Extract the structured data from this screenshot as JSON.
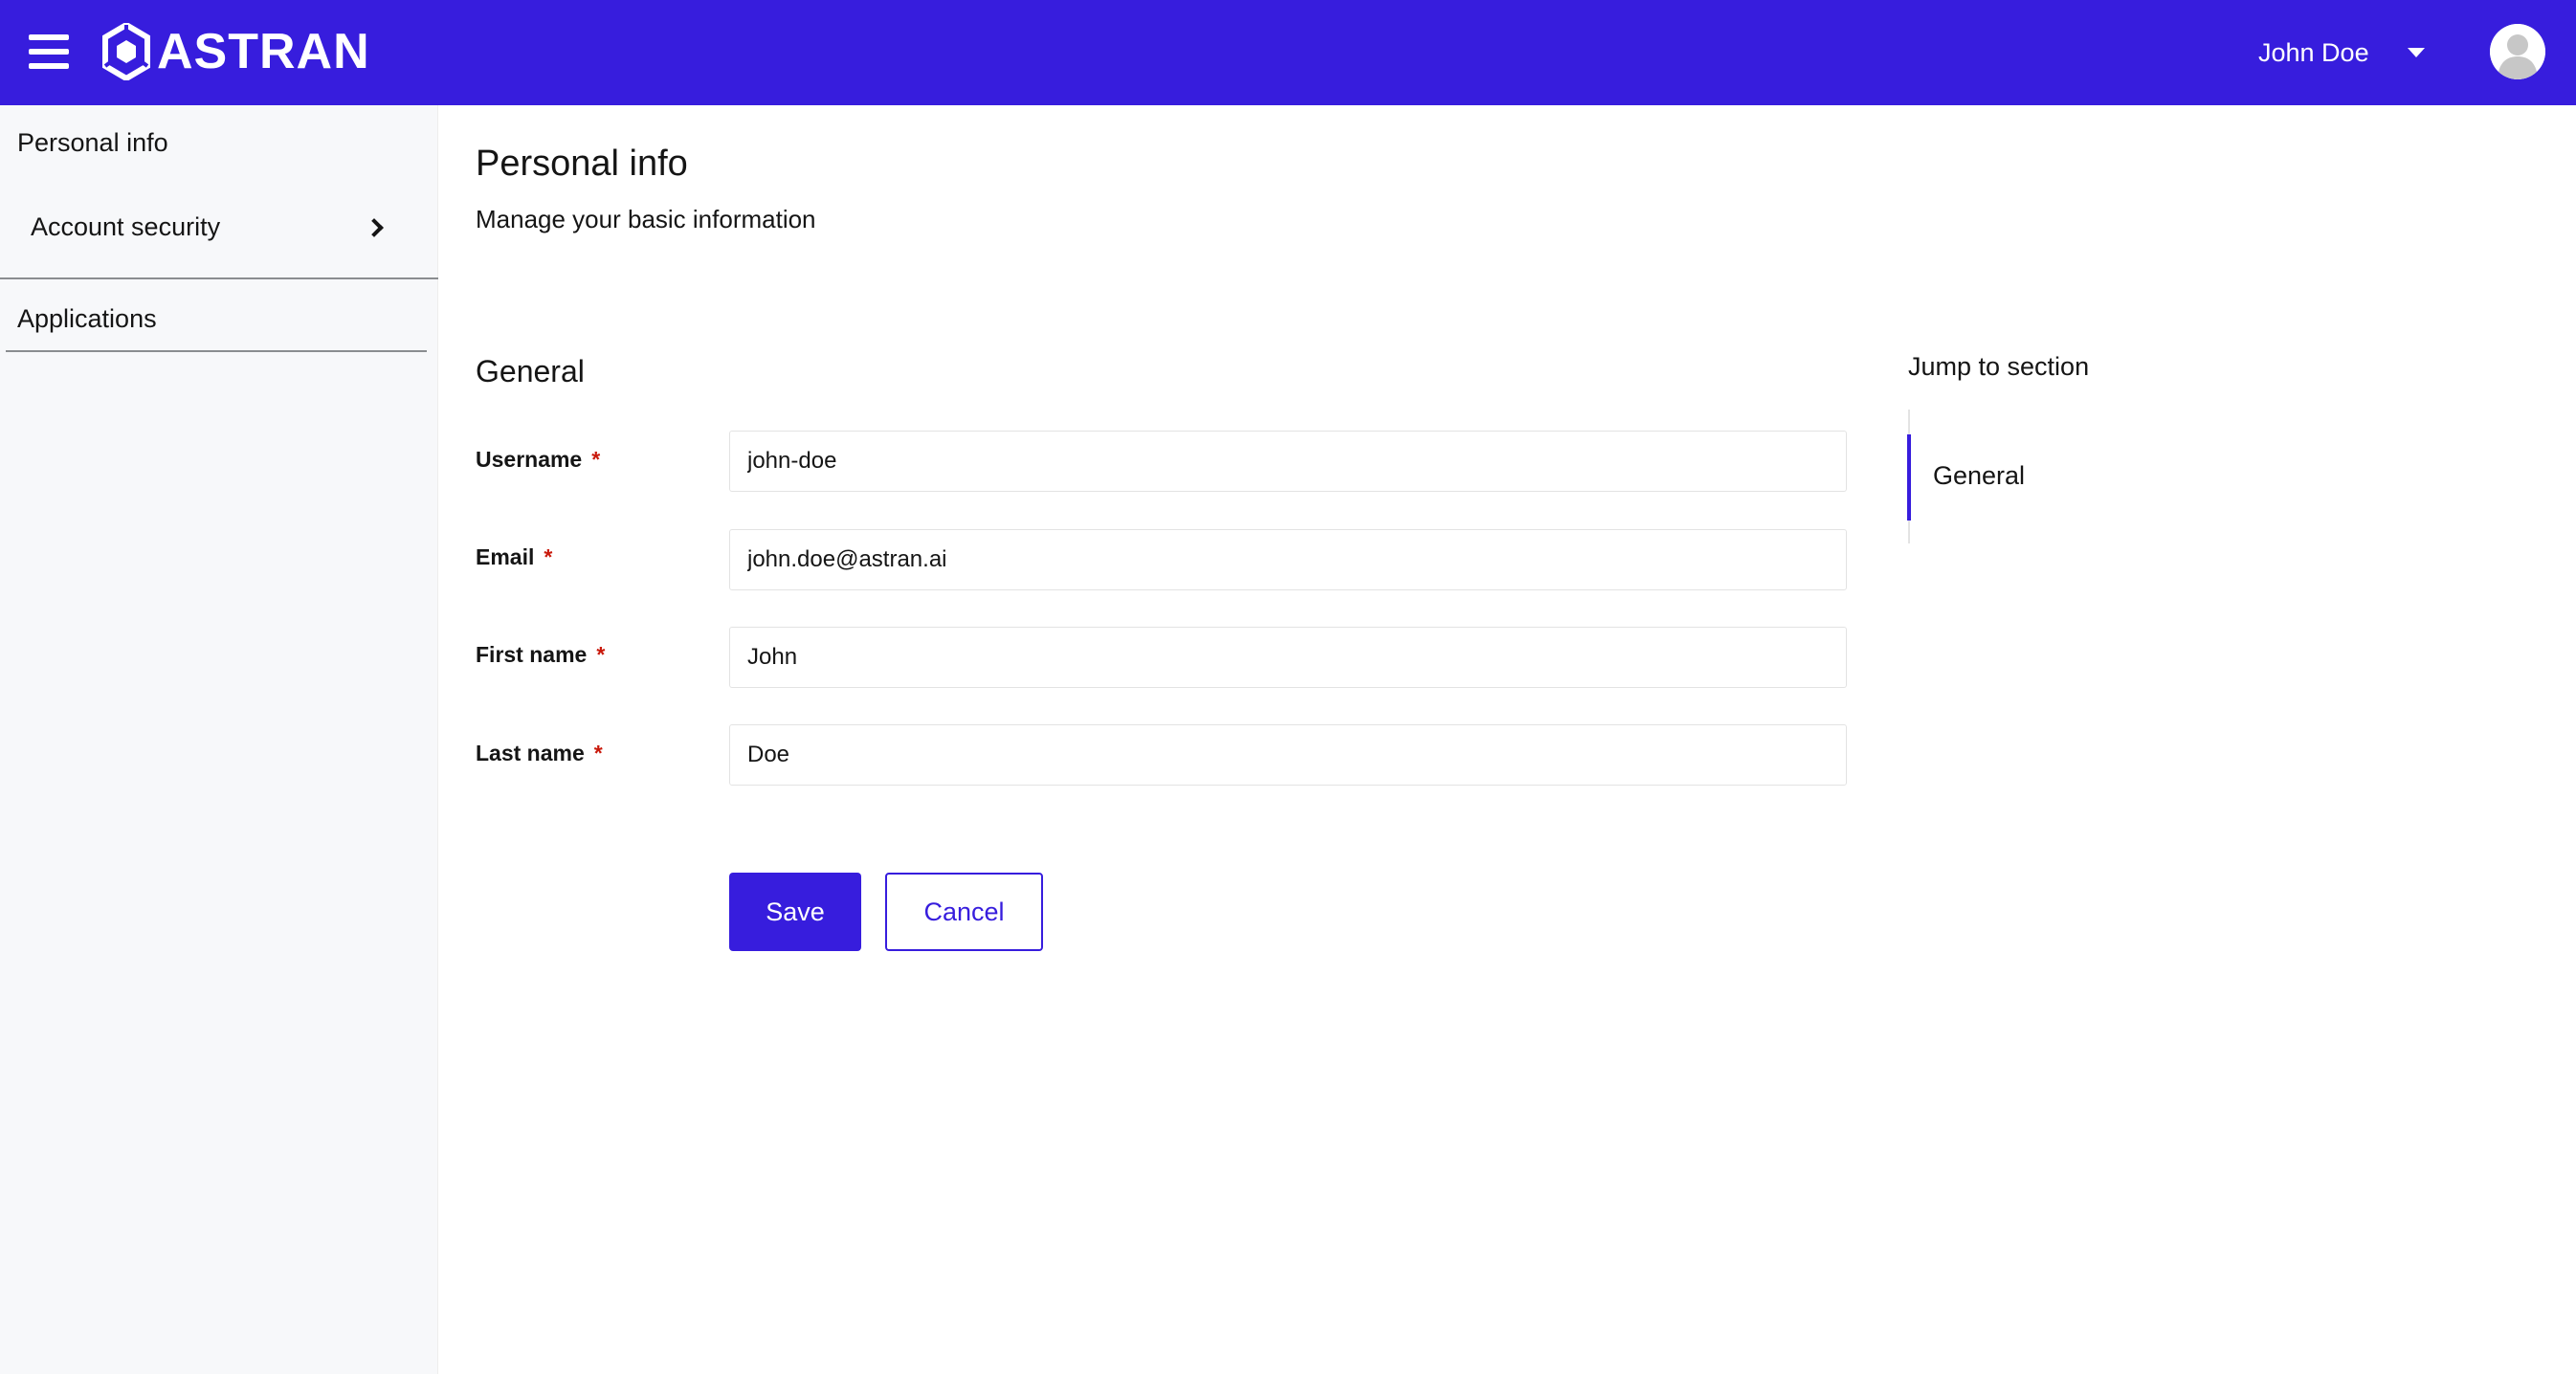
{
  "header": {
    "brand": "ASTRAN",
    "user_name": "John Doe",
    "colors": {
      "primary": "#371ddd",
      "header_text": "#ffffff"
    }
  },
  "sidebar": {
    "items": [
      {
        "label": "Personal info"
      },
      {
        "label": "Account security"
      },
      {
        "label": "Applications"
      }
    ]
  },
  "main": {
    "title": "Personal info",
    "subtitle": "Manage your basic information",
    "section_title": "General",
    "required_mark": "*",
    "fields": [
      {
        "label": "Username",
        "value": "john-doe"
      },
      {
        "label": "Email",
        "value": "john.doe@astran.ai"
      },
      {
        "label": "First name",
        "value": "John"
      },
      {
        "label": "Last name",
        "value": "Doe"
      }
    ],
    "save_label": "Save",
    "cancel_label": "Cancel"
  },
  "jump": {
    "title": "Jump to section",
    "links": [
      {
        "label": "General"
      }
    ]
  }
}
